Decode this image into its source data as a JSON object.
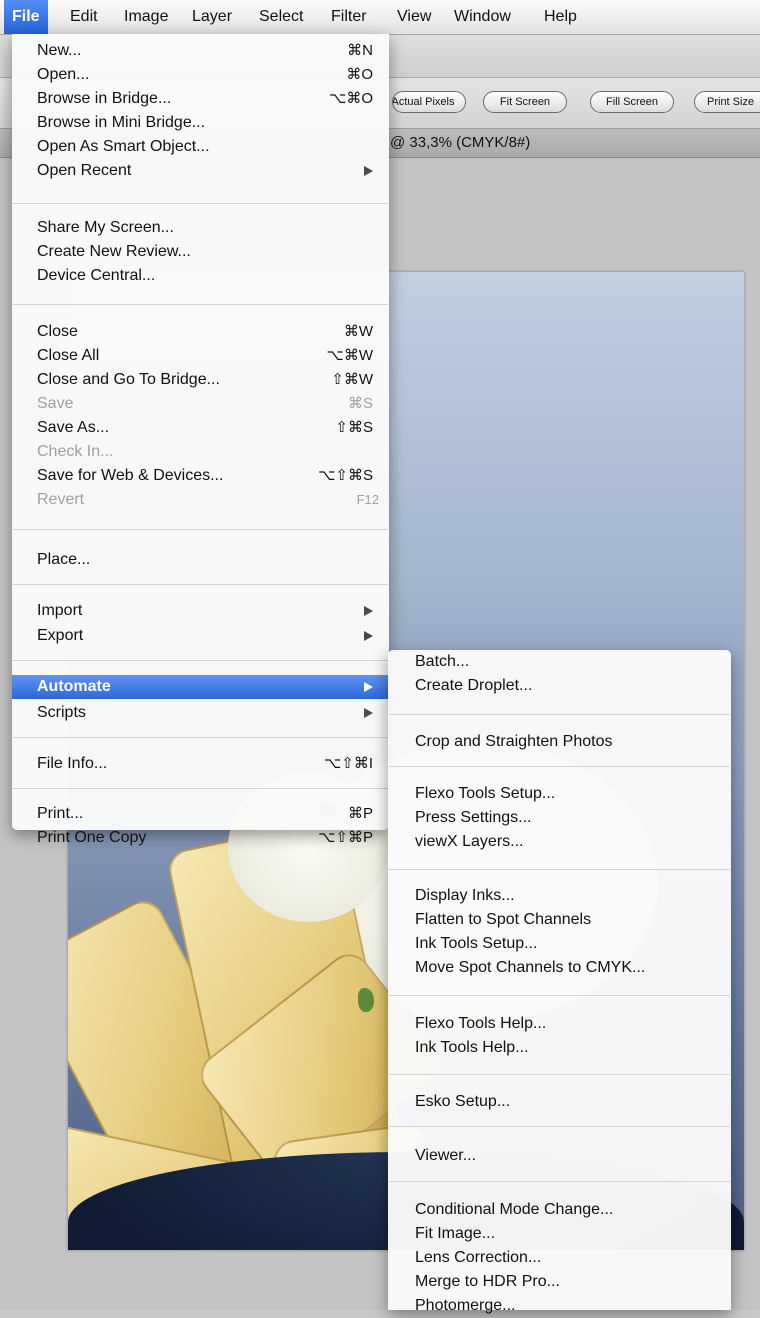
{
  "menubar": {
    "items": [
      "File",
      "Edit",
      "Image",
      "Layer",
      "Select",
      "Filter",
      "View",
      "Window",
      "Help"
    ],
    "active": "File"
  },
  "toolbar": {
    "actual_pixels": "Actual Pixels",
    "fit_screen": "Fit Screen",
    "fill_screen": "Fill Screen",
    "print_size": "Print Size"
  },
  "document": {
    "title": "@ 33,3% (CMYK/8#)"
  },
  "file_menu": {
    "new": {
      "label": "New...",
      "shortcut": "⌘N"
    },
    "open": {
      "label": "Open...",
      "shortcut": "⌘O"
    },
    "browse_bridge": {
      "label": "Browse in Bridge...",
      "shortcut": "⌥⌘O"
    },
    "browse_mini_bridge": {
      "label": "Browse in Mini Bridge..."
    },
    "open_smart_object": {
      "label": "Open As Smart Object..."
    },
    "open_recent": {
      "label": "Open Recent"
    },
    "share_screen": {
      "label": "Share My Screen..."
    },
    "create_review": {
      "label": "Create New Review..."
    },
    "device_central": {
      "label": "Device Central..."
    },
    "close": {
      "label": "Close",
      "shortcut": "⌘W"
    },
    "close_all": {
      "label": "Close All",
      "shortcut": "⌥⌘W"
    },
    "close_go_bridge": {
      "label": "Close and Go To Bridge...",
      "shortcut": "⇧⌘W"
    },
    "save": {
      "label": "Save",
      "shortcut": "⌘S"
    },
    "save_as": {
      "label": "Save As...",
      "shortcut": "⇧⌘S"
    },
    "check_in": {
      "label": "Check In..."
    },
    "save_web": {
      "label": "Save for Web & Devices...",
      "shortcut": "⌥⇧⌘S"
    },
    "revert": {
      "label": "Revert",
      "shortcut": "F12"
    },
    "place": {
      "label": "Place..."
    },
    "import": {
      "label": "Import"
    },
    "export": {
      "label": "Export"
    },
    "automate": {
      "label": "Automate"
    },
    "scripts": {
      "label": "Scripts"
    },
    "file_info": {
      "label": "File Info...",
      "shortcut": "⌥⇧⌘I"
    },
    "print": {
      "label": "Print...",
      "shortcut": "⌘P"
    },
    "print_one": {
      "label": "Print One Copy",
      "shortcut": "⌥⇧⌘P"
    }
  },
  "automate_menu": {
    "batch": "Batch...",
    "create_droplet": "Create Droplet...",
    "crop_straighten": "Crop and Straighten Photos",
    "flexo_setup": "Flexo Tools Setup...",
    "press_settings": "Press Settings...",
    "viewx_layers": "viewX Layers...",
    "display_inks": "Display Inks...",
    "flatten_spot": "Flatten to Spot Channels",
    "ink_setup": "Ink Tools Setup...",
    "move_spot_cmyk": "Move Spot Channels to CMYK...",
    "flexo_help": "Flexo Tools Help...",
    "ink_help": "Ink Tools Help...",
    "esko_setup": "Esko Setup...",
    "viewer": "Viewer...",
    "conditional_mode": "Conditional Mode Change...",
    "fit_image": "Fit Image...",
    "lens_correction": "Lens Correction...",
    "merge_hdr": "Merge to HDR Pro...",
    "photomerge": "Photomerge..."
  }
}
